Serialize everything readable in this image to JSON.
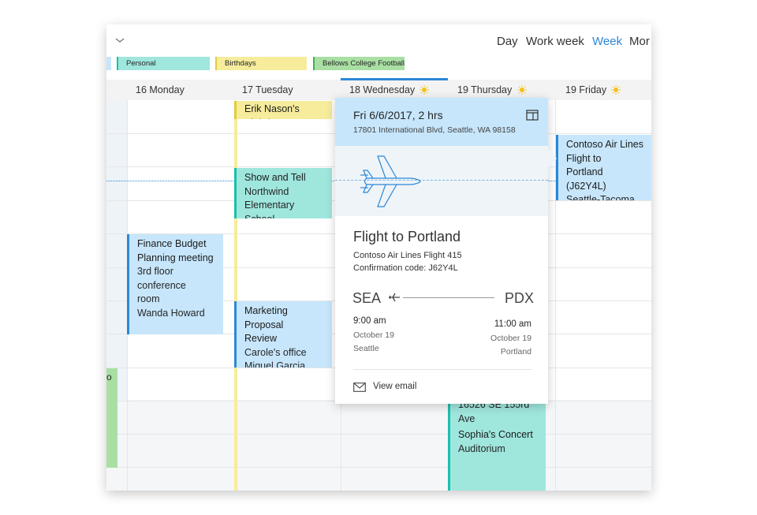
{
  "views": {
    "day": "Day",
    "workweek": "Work week",
    "week": "Week",
    "month": "Mor"
  },
  "categories": {
    "personal": "Personal",
    "birthdays": "Birthdays",
    "football": "Bellows College Football"
  },
  "days": {
    "mon": "16 Monday",
    "tue": "17 Tuesday",
    "wed": "18 Wednesday",
    "thu": "19 Thursday",
    "fri": "19 Friday"
  },
  "events": {
    "birthday": "Erik Nason's Birthda",
    "show_title": "Show and Tell",
    "show_l2": "Northwind",
    "show_l3": "Elementary School",
    "fin_title": "Finance Budget",
    "fin_l2": "Planning meeting",
    "fin_l3": "3rd floor conference",
    "fin_l4": "room",
    "fin_l5": "Wanda Howard",
    "mkt_title": "Marketing Proposal",
    "mkt_l2": "Review",
    "mkt_l3": "Carole's office",
    "mkt_l4": "Miguel Garcia",
    "flight_l1": "Contoso Air Lines",
    "flight_l2": "Flight to",
    "flight_l3": "Portland (J62Y4L)",
    "flight_l4": "Seattle-Tacoma Int",
    "addr": "16526 SE 155rd Ave",
    "concert_title": "Sophia's Concert",
    "concert_l2": "Auditorium",
    "green_char": "o"
  },
  "popup": {
    "date": "Fri 6/6/2017, 2 hrs",
    "address": "17801 International Blvd, Seattle, WA 98158",
    "title": "Flight to Portland",
    "airline": "Contoso Air Lines Flight 415",
    "confirmation": "Confirmation code: J62Y4L",
    "from_code": "SEA",
    "to_code": "PDX",
    "dep_time": "9:00 am",
    "dep_date": "October 19",
    "dep_city": "Seattle",
    "arr_time": "11:00 am",
    "arr_date": "October 19",
    "arr_city": "Portland",
    "view_email": "View email"
  },
  "colors": {
    "accent": "#2b88d8",
    "personal": "#9fe6dd",
    "birthday": "#f6ec9c",
    "green": "#a9dfa3",
    "blue_event": "#c7e6fb",
    "teal_event": "#9fe6dd"
  },
  "icons": [
    "chevron-down-icon",
    "sun-icon",
    "calendar-icon",
    "airplane-icon",
    "mail-icon"
  ]
}
